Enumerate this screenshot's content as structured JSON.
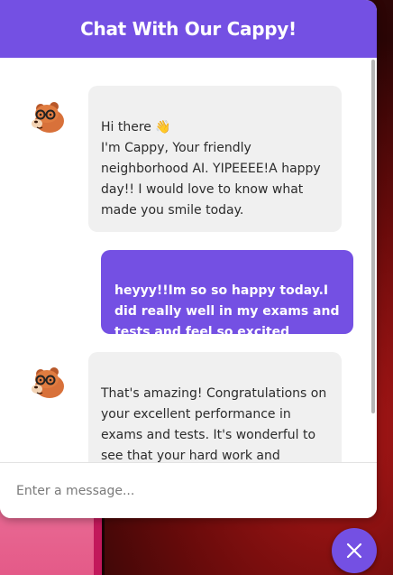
{
  "header": {
    "title": "Chat With Our Cappy!"
  },
  "messages": [
    {
      "sender": "bot",
      "text": "Hi there 👋\nI'm Cappy, Your friendly neighborhood AI. YIPEEEE!A happy day!!  I would love to know what made you smile today."
    },
    {
      "sender": "user",
      "text": "heyyy!!Im so so happy today.I did really well in my exams and tests and feel so excited"
    },
    {
      "sender": "bot",
      "text": "That's amazing! Congratulations on your excellent performance in exams and tests. It's wonderful to see that your hard work and dedication paid off."
    }
  ],
  "input": {
    "placeholder": "Enter a message...",
    "value": ""
  },
  "icons": {
    "avatar": "capybara-avatar-icon",
    "close": "close-icon"
  },
  "colors": {
    "brand": "#7450e3",
    "bot_bubble": "#f0f0f0",
    "user_text": "#ffffff"
  }
}
